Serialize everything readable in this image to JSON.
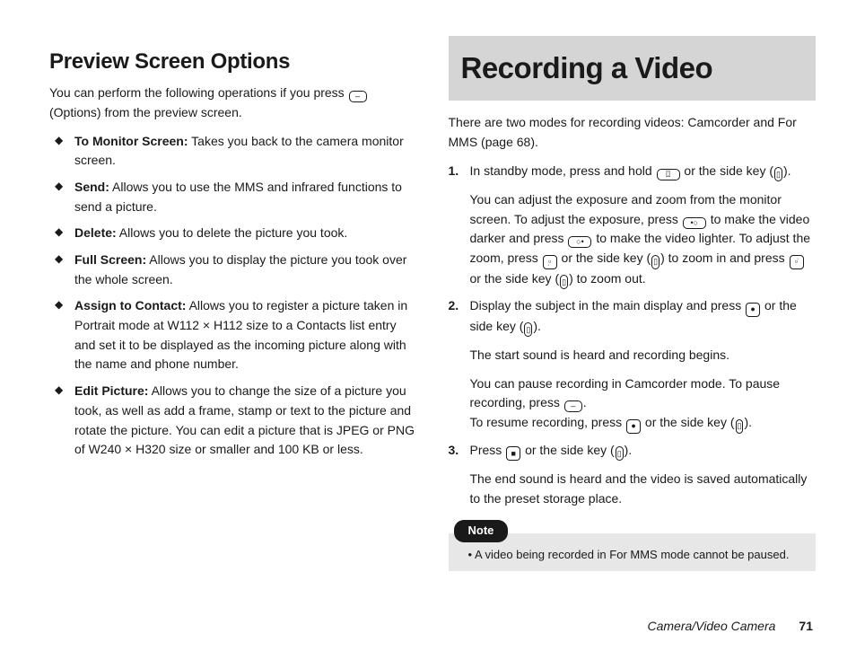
{
  "left": {
    "heading": "Preview Screen Options",
    "intro_before": "You can perform the following operations if you press ",
    "intro_key_label": "–",
    "intro_after": " (Options) from the preview screen.",
    "items": [
      {
        "title": "To Monitor Screen:",
        "body": " Takes you back to the camera monitor screen."
      },
      {
        "title": "Send:",
        "body": " Allows you to use the MMS and infrared functions to send a picture."
      },
      {
        "title": "Delete:",
        "body": " Allows you to delete the picture you took."
      },
      {
        "title": "Full Screen:",
        "body": " Allows you to display the picture you took over the whole screen."
      },
      {
        "title": "Assign to Contact:",
        "body": " Allows you to register a picture taken in Portrait mode at W112 × H112 size to a Contacts list entry and set it to be displayed as the incoming picture along with the name and phone number."
      },
      {
        "title": "Edit Picture:",
        "body": " Allows you to change the size of a picture you took, as well as add a frame, stamp or text to the picture and rotate the picture. You can edit a picture that is JPEG or PNG of W240 × H320 size or smaller and 100 KB or less."
      }
    ]
  },
  "right": {
    "heading": "Recording a Video",
    "intro": "There are two modes for recording videos: Camcorder and For MMS (page 68).",
    "steps": {
      "s1": {
        "a1": "In standby mode, press and hold ",
        "a2": " or the side key (",
        "a3": ").",
        "b1": "You can adjust the exposure and zoom from the monitor screen. To adjust the exposure, press ",
        "b2": " to make the video darker and press ",
        "b3": " to make the video lighter. To adjust the zoom, press ",
        "b4": " or the side key (",
        "b5": ") to zoom in and press ",
        "b6": " or the side key (",
        "b7": ") to zoom out."
      },
      "s2": {
        "a1": "Display the subject in the main display and press ",
        "a2": " or the side key (",
        "a3": ").",
        "b": "The start sound is heard and recording begins.",
        "c1": "You can pause recording in Camcorder mode. To pause recording, press ",
        "c2": ".",
        "c3": "To resume recording, press ",
        "c4": " or the side key (",
        "c5": ")."
      },
      "s3": {
        "a1": "Press ",
        "a2": " or the side key (",
        "a3": ").",
        "b": "The end sound is heard and the video is saved automatically to the preset storage place."
      }
    },
    "note_label": "Note",
    "note_body": "A video being recorded in For MMS mode cannot be paused."
  },
  "keys": {
    "softkey": "–",
    "camera": "⌼",
    "expo_left": "•○",
    "expo_right": "○•",
    "nav_up": "▫̣",
    "nav_down": "▫̇",
    "center": "●",
    "stop": "■",
    "side": "▯"
  },
  "footer": {
    "section": "Camera/Video Camera",
    "page": "71"
  }
}
